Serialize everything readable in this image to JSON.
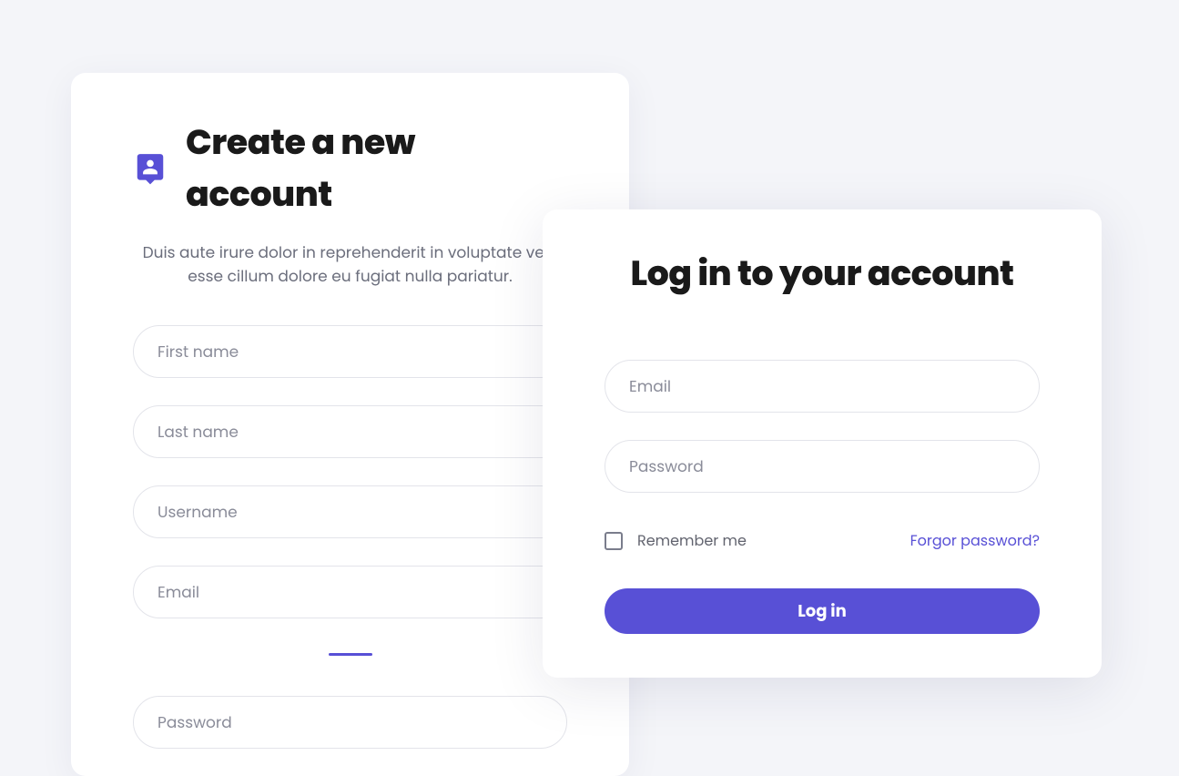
{
  "colors": {
    "accent": "#5850d6"
  },
  "create": {
    "title": "Create a new account",
    "description": "Duis aute irure dolor in reprehenderit in voluptate velit esse cillum dolore eu fugiat nulla pariatur.",
    "first_name_placeholder": "First name",
    "last_name_placeholder": "Last name",
    "username_placeholder": "Username",
    "email_placeholder": "Email",
    "password_placeholder": "Password"
  },
  "login": {
    "title": "Log in to your account",
    "email_placeholder": "Email",
    "password_placeholder": "Password",
    "remember_label": "Remember me",
    "forgot_label": "Forgor password?",
    "submit_label": "Log in"
  }
}
